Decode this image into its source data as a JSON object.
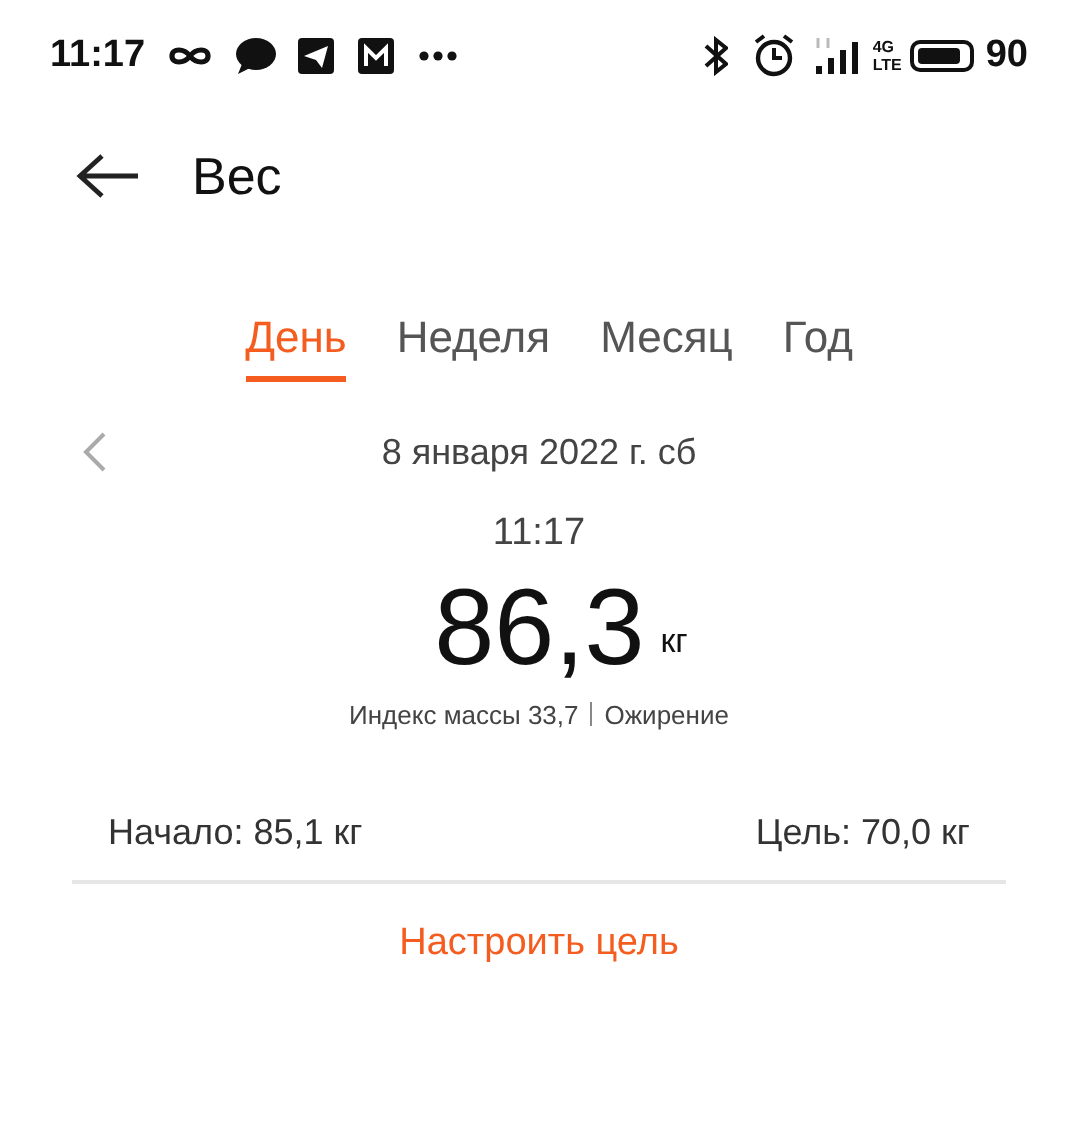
{
  "status_bar": {
    "time": "11:17",
    "network": [
      "4G",
      "LTE"
    ],
    "battery": "90"
  },
  "header": {
    "title": "Вес"
  },
  "tabs": [
    {
      "label": "День",
      "selected": true
    },
    {
      "label": "Неделя",
      "selected": false
    },
    {
      "label": "Месяц",
      "selected": false
    },
    {
      "label": "Год",
      "selected": false
    }
  ],
  "date": "8 января 2022 г. сб",
  "measurement": {
    "time": "11:17",
    "value": "86,3",
    "unit": "кг",
    "bmi": "Индекс массы 33,7",
    "category": "Ожирение"
  },
  "summary": {
    "start": "Начало: 85,1 кг",
    "goal": "Цель: 70,0 кг"
  },
  "action": "Настроить цель"
}
